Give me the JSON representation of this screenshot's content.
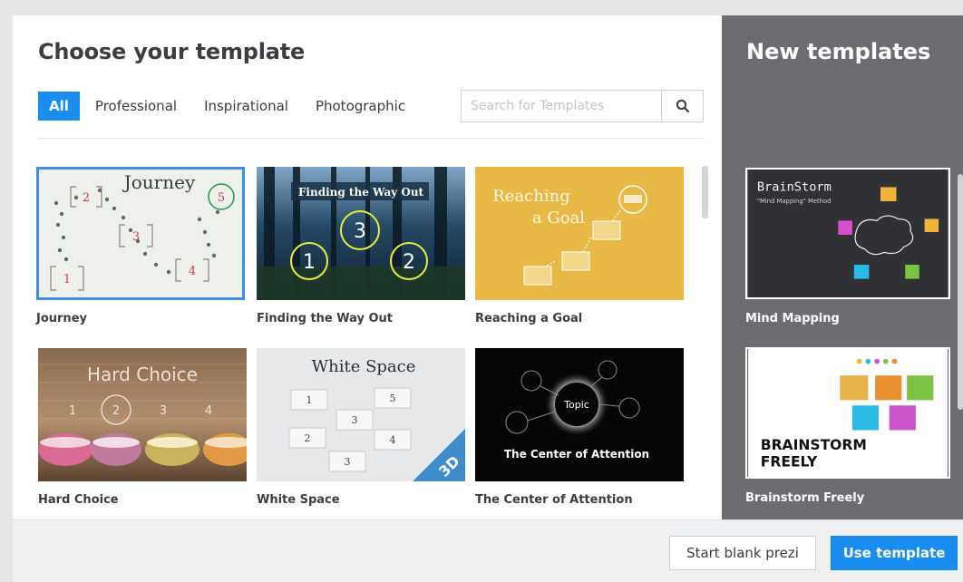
{
  "dialog": {
    "title": "Choose your template",
    "tabs": [
      {
        "label": "All",
        "active": true
      },
      {
        "label": "Professional"
      },
      {
        "label": "Inspirational"
      },
      {
        "label": "Photographic"
      }
    ],
    "search": {
      "placeholder": "Search for Templates",
      "icon": "search-icon"
    },
    "templates": [
      {
        "label": "Journey",
        "thumb_title": "Journey",
        "numbers": [
          "2",
          "5",
          "3",
          "4",
          "1"
        ],
        "selected": true
      },
      {
        "label": "Finding the Way Out",
        "thumb_title": "Finding the Way Out",
        "numbers": [
          "3",
          "1",
          "2"
        ]
      },
      {
        "label": "Reaching a Goal",
        "thumb_title_line1": "Reaching",
        "thumb_title_line2": "a Goal"
      },
      {
        "label": "Hard Choice",
        "thumb_title": "Hard Choice",
        "numbers": [
          "1",
          "2",
          "3",
          "4"
        ]
      },
      {
        "label": "White Space",
        "thumb_title": "White Space",
        "numbers": [
          "1",
          "5",
          "3",
          "2",
          "4",
          "3"
        ],
        "badge": "3D"
      },
      {
        "label": "The Center of Attention",
        "thumb_title": "The Center of Attention",
        "center_word": "Topic"
      }
    ]
  },
  "sidebar": {
    "title": "New templates",
    "templates": [
      {
        "label": "Mind Mapping",
        "thumb_title": "BrainStorm",
        "thumb_subtitle": "\"Mind Mapping\" Method"
      },
      {
        "label": "Brainstorm Freely",
        "thumb_line1": "BRAINSTORM",
        "thumb_line2": "FREELY"
      }
    ]
  },
  "footer": {
    "blank_label": "Start blank prezi",
    "use_label": "Use template"
  },
  "colors": {
    "accent": "#1a8df0",
    "sidebar_bg": "#6b6d70",
    "selected_outline": "#3c8ee8"
  }
}
